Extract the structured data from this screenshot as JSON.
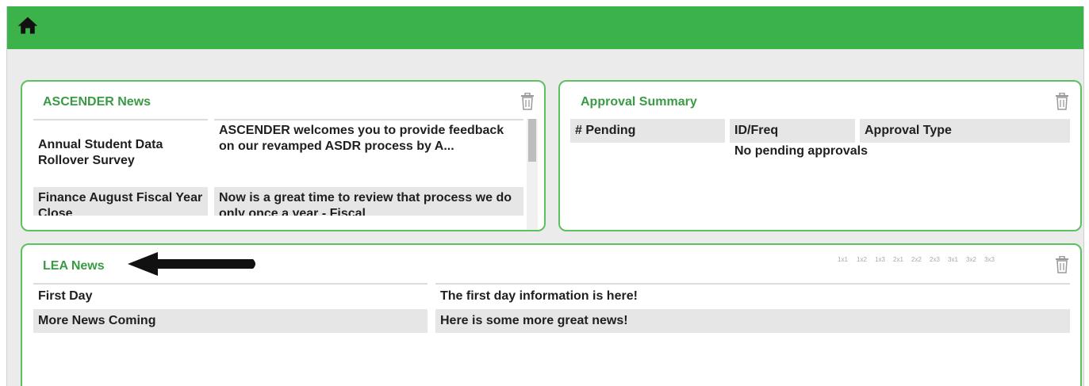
{
  "colors": {
    "topbar": "#3bb34a",
    "panel_border": "#5cc15f",
    "title_green": "#3a9a45"
  },
  "header": {
    "home_icon": "home-icon"
  },
  "ascender_news": {
    "title": "ASCENDER News",
    "items": [
      {
        "headline": "Annual Student Data Rollover Survey",
        "summary": "ASCENDER welcomes you to provide feedback on our revamped ASDR process by A..."
      },
      {
        "headline": "Finance August Fiscal Year Close",
        "summary": "Now is a great time to review that process we do only once a year - Fiscal"
      }
    ]
  },
  "approval_summary": {
    "title": "Approval Summary",
    "columns": [
      "# Pending",
      "ID/Freq",
      "Approval Type"
    ],
    "empty_message": "No pending approvals"
  },
  "lea_news": {
    "title": "LEA News",
    "size_options": [
      "1x1",
      "1x2",
      "1x3",
      "2x1",
      "2x2",
      "2x3",
      "3x1",
      "3x2",
      "3x3"
    ],
    "items": [
      {
        "headline": "First Day",
        "summary": "The first day information is here!"
      },
      {
        "headline": "More News Coming",
        "summary": "Here is some more great news!"
      }
    ]
  }
}
